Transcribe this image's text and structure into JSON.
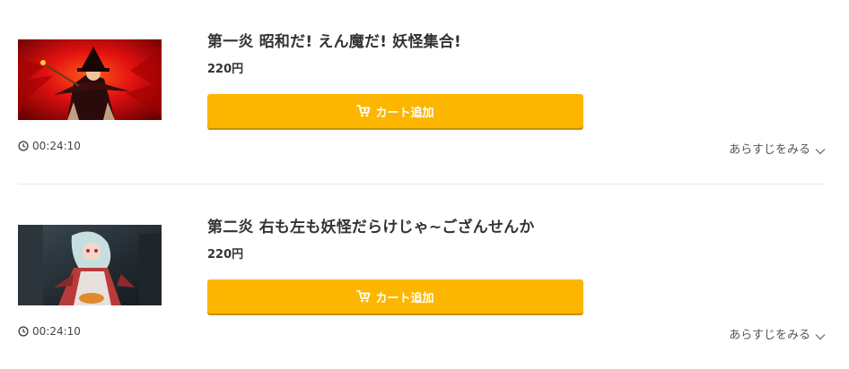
{
  "episodes": [
    {
      "title": "第一炎 昭和だ! えん魔だ! 妖怪集合!",
      "price": "220円",
      "cart_label": "カート追加",
      "duration": "00:24:10",
      "synopsis_label": "あらすじをみる",
      "thumbnail_icon": "episode-thumbnail-red-scene"
    },
    {
      "title": "第二炎 右も左も妖怪だらけじゃ~ござんせんか",
      "price": "220円",
      "cart_label": "カート追加",
      "duration": "00:24:10",
      "synopsis_label": "あらすじをみる",
      "thumbnail_icon": "episode-thumbnail-dark-scene"
    }
  ],
  "colors": {
    "cart_button": "#fcb600",
    "cart_button_shadow": "#c98f00",
    "text": "#333333",
    "divider": "#e6e6e6"
  }
}
